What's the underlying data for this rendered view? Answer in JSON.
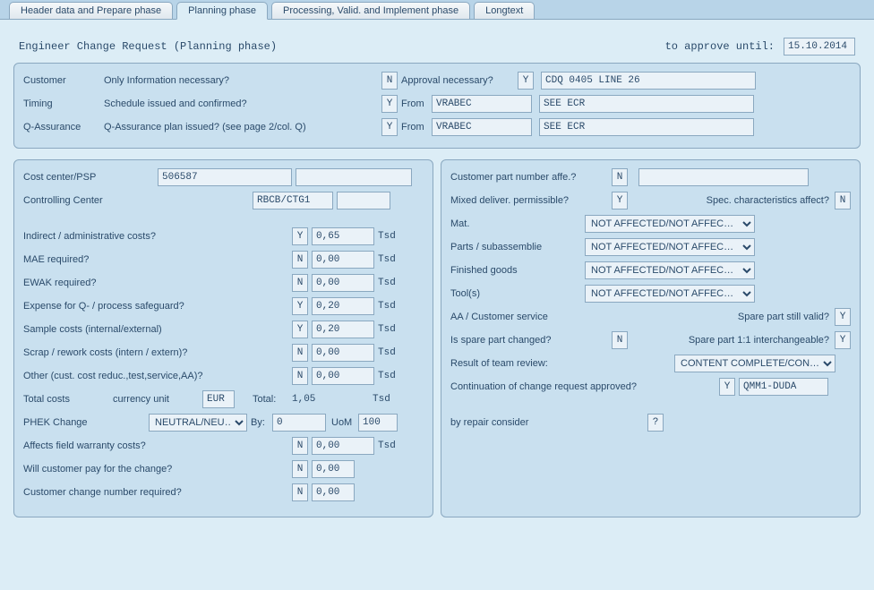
{
  "tabs": {
    "t0": "Header data and Prepare phase",
    "t1": "Planning phase",
    "t2": "Processing, Valid. and Implement phase",
    "t3": "Longtext"
  },
  "titleRow": {
    "title": "Engineer Change Request (Planning phase)",
    "approveLabel": "to approve until:",
    "approveDate": "15.10.2014"
  },
  "header": {
    "customerLabel": "Customer",
    "customerQ": "Only Information necessary?",
    "customerYN": "N",
    "approvalQ": "Approval necessary?",
    "approvalYN": "Y",
    "approvalVal": "CDQ 0405 LINE 26",
    "timingLabel": "Timing",
    "timingQ": "Schedule issued and confirmed?",
    "timingYN": "Y",
    "fromLabel": "From",
    "from1": "VRABEC",
    "seeEcr1": "SEE ECR",
    "qaLabel": "Q-Assurance",
    "qaQ": "Q-Assurance plan issued? (see page 2/col. Q)",
    "qaYN": "Y",
    "from2": "VRABEC",
    "seeEcr2": "SEE ECR"
  },
  "left": {
    "costCenterLabel": "Cost center/PSP",
    "costCenterVal": "506587",
    "controllingLabel": "Controlling Center",
    "controllingVal": "RBCB/CTG1",
    "rows": [
      {
        "label": "Indirect / administrative costs?",
        "yn": "Y",
        "val": "0,65",
        "unit": "Tsd"
      },
      {
        "label": "MAE required?",
        "yn": "N",
        "val": "0,00",
        "unit": "Tsd"
      },
      {
        "label": "EWAK required?",
        "yn": "N",
        "val": "0,00",
        "unit": "Tsd"
      },
      {
        "label": "Expense for Q- / process safeguard?",
        "yn": "Y",
        "val": "0,20",
        "unit": "Tsd"
      },
      {
        "label": "Sample costs (internal/external)",
        "yn": "Y",
        "val": "0,20",
        "unit": "Tsd"
      },
      {
        "label": "Scrap / rework costs (intern / extern)?",
        "yn": "N",
        "val": "0,00",
        "unit": "Tsd"
      },
      {
        "label": "Other (cust. cost reduc.,test,service,AA)?",
        "yn": "N",
        "val": "0,00",
        "unit": "Tsd"
      }
    ],
    "totalLabel": "Total costs",
    "currencyLabel": "currency unit",
    "currency": "EUR",
    "totalTextLabel": "Total:",
    "totalVal": "1,05",
    "totalUnit": "Tsd",
    "phekLabel": "PHEK  Change",
    "phekVal": "NEUTRAL/NEU…",
    "byLabel": "By:",
    "byVal": "0",
    "uomLabel": "UoM",
    "uomVal": "100",
    "affectsLabel": "Affects field warranty costs?",
    "affectsYN": "N",
    "affectsVal": "0,00",
    "affectsUnit": "Tsd",
    "willPayLabel": "Will customer pay for the change?",
    "willPayYN": "N",
    "willPayVal": "0,00",
    "custChangeLabel": "Customer change number required?",
    "custChangeYN": "N",
    "custChangeVal": "0,00"
  },
  "right": {
    "custPartLabel": "Customer part number affe.?",
    "custPartYN": "N",
    "mixedLabel": "Mixed deliver. permissible?",
    "mixedYN": "Y",
    "specLabel": "Spec. characteristics affect?",
    "specYN": "N",
    "matLabel": "Mat.",
    "matVal": "NOT AFFECTED/NOT AFFEC…",
    "partsLabel": "Parts / subassemblie",
    "partsVal": "NOT AFFECTED/NOT AFFEC…",
    "finishedLabel": "Finished goods",
    "finishedVal": "NOT AFFECTED/NOT AFFEC…",
    "toolsLabel": "Tool(s)",
    "toolsVal": "NOT AFFECTED/NOT AFFEC…",
    "aaLabel": "AA / Customer service",
    "sparePartValidLabel": "Spare part still valid?",
    "sparePartValidYN": "Y",
    "spareChangedLabel": "Is spare part changed?",
    "spareChangedYN": "N",
    "interchangeableLabel": "Spare part 1:1 interchangeable?",
    "interchangeableYN": "Y",
    "reviewLabel": "Result of team review:",
    "reviewVal": "CONTENT COMPLETE/CON…",
    "contLabel": "Continuation of change request approved?",
    "contYN": "Y",
    "contVal": "QMM1-DUDA",
    "repairLabel": "by repair consider",
    "repairYN": "?"
  }
}
